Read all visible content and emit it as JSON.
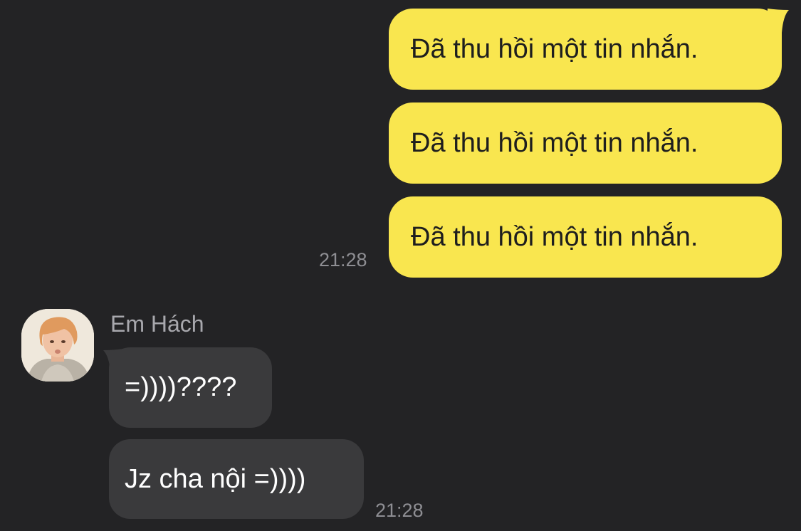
{
  "colors": {
    "background": "#232325",
    "outgoing_bubble": "#F9E64F",
    "incoming_bubble": "#3A3A3C",
    "timestamp": "#8E8E93"
  },
  "conversation": {
    "outgoing": {
      "messages": [
        "Đã thu hồi một tin nhắn.",
        "Đã thu hồi một tin nhắn.",
        "Đã thu hồi một tin nhắn."
      ],
      "time": "21:28"
    },
    "incoming": {
      "sender_name": "Em Hách",
      "avatar_icon": "profile-photo-avatar",
      "messages": [
        "=))))????",
        "Jz cha nội =))))"
      ],
      "time": "21:28"
    }
  }
}
